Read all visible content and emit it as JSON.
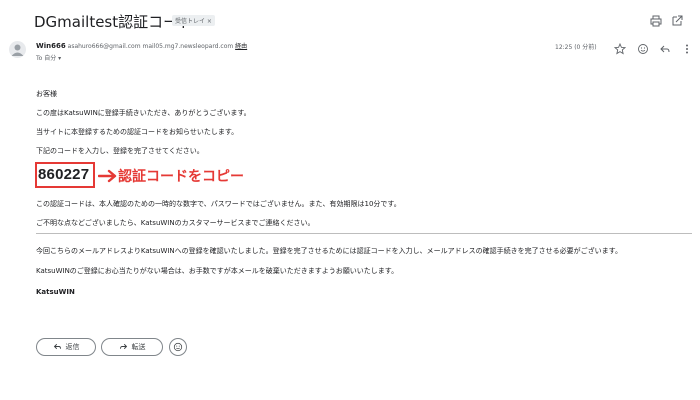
{
  "header": {
    "subject": "DGmailtest認証コード",
    "label_chip": "受信トレイ ×",
    "print_icon": "print-icon",
    "open_new_window_icon": "open-in-new-window-icon"
  },
  "sender": {
    "name": "Win666",
    "email": "asahuro666@gmail.com",
    "via_prefix": "mail05.mg7.newsleopard.com",
    "via_link": "経由",
    "to_line": "To 自分 ▾",
    "time": "12:25 (0 分前)",
    "icons": [
      "star-icon",
      "emoji-icon",
      "reply-icon",
      "more-vertical-icon"
    ]
  },
  "body": {
    "greeting": "お客様",
    "p1": "この度はKatsuWINに登録手続きいただき、ありがとうございます。",
    "p2": "当サイトに本登録するための認証コードをお知らせいたします。",
    "p3": "下記のコードを入力し、登録を完了させてください。",
    "code": "860227",
    "copy_label": "認証コードをコピー",
    "p4": "この認証コードは、本人確認のための一時的な数字で、パスワードではございません。また、有効期限は10分です。",
    "p5": "ご不明な点などございましたら、KatsuWINのカスタマーサービスまでご連絡ください。",
    "p6": "今回こちらのメールアドレスよりKatsuWINへの登録を確認いたしました。登録を完了させるためには認証コードを入力し、メールアドレスの確認手続きを完了させる必要がございます。",
    "p7": "KatsuWINのご登録にお心当たりがない場合は、お手数ですが本メールを破棄いただきますようお願いいたします。",
    "signature": "KatsuWIN"
  },
  "actions": {
    "reply_label": "返信",
    "forward_label": "転送"
  },
  "colors": {
    "highlight_red": "#e53935",
    "text": "#202124",
    "muted": "#5f6368"
  }
}
